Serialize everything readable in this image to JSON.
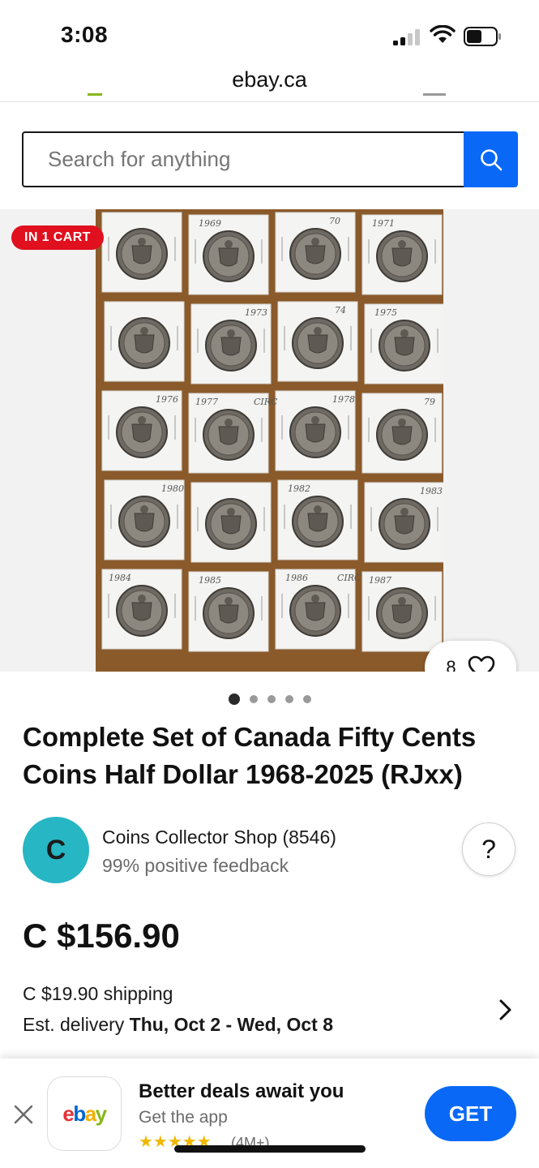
{
  "status": {
    "time": "3:08"
  },
  "browser": {
    "url": "ebay.ca"
  },
  "search": {
    "placeholder": "Search for anything"
  },
  "gallery": {
    "badge": "IN 1 CART",
    "watch_count": "8",
    "image_count": 5,
    "active_index": 0,
    "coin_labels": [
      [
        "",
        "1969",
        "70",
        "1971"
      ],
      [
        "",
        "1973",
        "74",
        "1975"
      ],
      [
        "1976",
        "1977",
        "CIRC",
        "1978",
        "79"
      ],
      [
        "1980",
        "",
        "1982",
        "1983"
      ],
      [
        "1984",
        "1985",
        "1986",
        "CIRC",
        "1987"
      ]
    ]
  },
  "listing": {
    "title": "Complete Set of Canada Fifty Cents Coins Half Dollar 1968-2025 (RJxx)",
    "seller_initial": "C",
    "seller_name": "Coins Collector Shop (8546)",
    "seller_feedback": "99% positive feedback",
    "help": "?",
    "price": "C $156.90",
    "shipping": "C $19.90 shipping",
    "delivery_label": "Est. delivery",
    "delivery_dates": "Thu, Oct 2 - Wed, Oct 8"
  },
  "app_banner": {
    "title": "Better deals await you",
    "subtitle": "Get the app",
    "stars": "★★★★★",
    "rating_count": "(4M+)",
    "button": "GET",
    "logo": {
      "e": "e",
      "b": "b",
      "a": "a",
      "y": "y"
    }
  },
  "colors": {
    "accent": "#0968f6",
    "badge": "#e0101e",
    "avatar": "#26b6c4",
    "logo_e": "#e53238",
    "logo_b": "#0064d2",
    "logo_a": "#f5af02",
    "logo_y": "#86b817"
  }
}
